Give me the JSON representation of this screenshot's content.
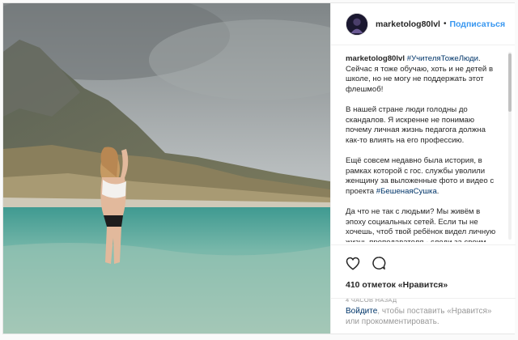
{
  "post": {
    "username": "marketolog80lvl",
    "separator": "•",
    "follow_label": "Подписаться"
  },
  "caption": {
    "username": "marketolog80lvl",
    "hashtag1": "#УчителяТожеЛюди",
    "p1_rest": ". Сейчас я тоже обучаю, хоть и не детей в школе, но не могу не поддержать этот флешмоб!",
    "p2": "В нашей стране люди голодны до скандалов. Я искренне не понимаю почему личная жизнь педагога должна как-то влиять на его профессию.",
    "p3_start": "Ещё совсем недавно была история, в рамках которой с гос. службы уволили женщину за выложенные фото и видео с проекта ",
    "hashtag2": "#БешенаяСушка",
    "p3_end": ".",
    "p4": "Да что не так с людьми? Мы живём в эпоху социальных сетей. Если ты не хочешь, чтоб твой ребёнок видел личную жизнь преподавателя - следи за своим ребёнком, а не мешай жить"
  },
  "actions": {
    "like_icon": "heart-icon",
    "comment_icon": "comment-icon",
    "likes_text": "410 отметок «Нравится»",
    "time_text": "4 часов назад"
  },
  "login": {
    "link": "Войдите",
    "rest": ", чтобы поставить «Нравится» или прокомментировать."
  },
  "colors": {
    "accent": "#3897f0",
    "hashtag": "#003569",
    "text": "#262626",
    "muted": "#999999"
  }
}
